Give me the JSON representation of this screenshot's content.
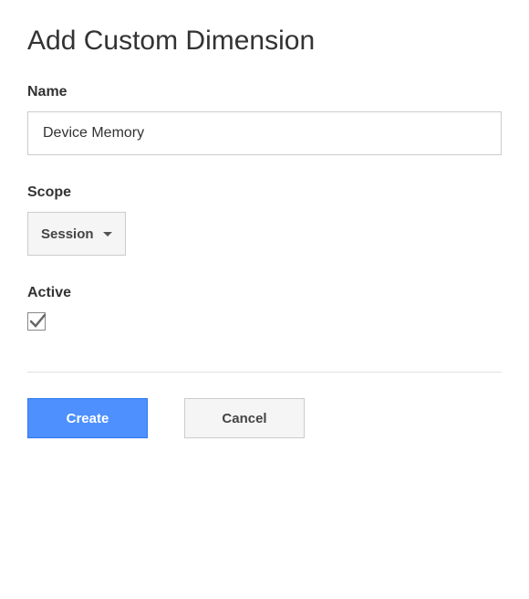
{
  "title": "Add Custom Dimension",
  "fields": {
    "name": {
      "label": "Name",
      "value": "Device Memory"
    },
    "scope": {
      "label": "Scope",
      "selected": "Session"
    },
    "active": {
      "label": "Active",
      "checked": true
    }
  },
  "buttons": {
    "create": "Create",
    "cancel": "Cancel"
  }
}
